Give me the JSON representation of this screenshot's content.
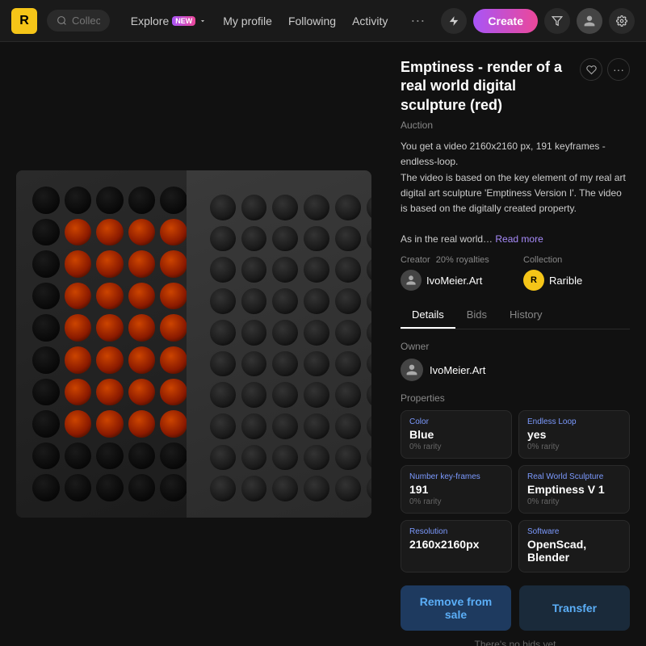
{
  "nav": {
    "logo": "R",
    "search_placeholder": "Collection, item or user",
    "links": [
      {
        "id": "explore",
        "label": "Explore",
        "has_new": true
      },
      {
        "id": "my-profile",
        "label": "My profile"
      },
      {
        "id": "following",
        "label": "Following"
      },
      {
        "id": "activity",
        "label": "Activity"
      }
    ],
    "more_label": "···",
    "create_label": "Create"
  },
  "item": {
    "title": "Emptiness - render of a real world digital sculpture (red)",
    "type": "Auction",
    "description_part1": "You get a video 2160x2160 px, 191 keyframes - endless-loop.",
    "description_part2": "The video is based on the key element of my real art digital art sculpture 'Emptiness Version I'. The video is based on the digitally created property.",
    "description_part3": "As in the real world…",
    "read_more": "Read more"
  },
  "creator": {
    "label": "Creator",
    "royalties": "20% royalties",
    "name": "IvoMeier.Art"
  },
  "collection": {
    "label": "Collection",
    "name": "Rarible"
  },
  "tabs": [
    {
      "id": "details",
      "label": "Details"
    },
    {
      "id": "bids",
      "label": "Bids"
    },
    {
      "id": "history",
      "label": "History"
    }
  ],
  "active_tab": "details",
  "owner": {
    "label": "Owner",
    "name": "IvoMeier.Art"
  },
  "properties": {
    "label": "Properties",
    "items": [
      {
        "type": "Color",
        "value": "Blue",
        "rarity": "0% rarity"
      },
      {
        "type": "Endless Loop",
        "value": "yes",
        "rarity": "0% rarity"
      },
      {
        "type": "Number key-frames",
        "value": "191",
        "rarity": "0% rarity"
      },
      {
        "type": "Real World Sculpture",
        "value": "Emptiness V 1",
        "rarity": "0% rarity"
      },
      {
        "type": "Resolution",
        "value": "2160x2160px",
        "rarity": ""
      },
      {
        "type": "Software",
        "value": "OpenScad, Blender",
        "rarity": ""
      }
    ]
  },
  "buttons": {
    "remove_from_sale": "Remove from sale",
    "transfer": "Transfer"
  },
  "no_bids_text": "There's no bids yet"
}
